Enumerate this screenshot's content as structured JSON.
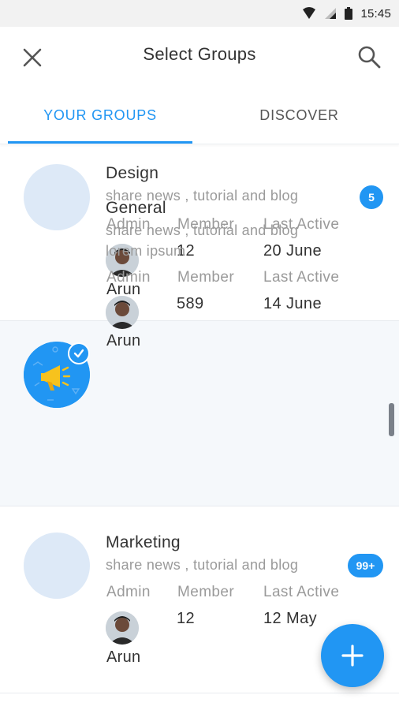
{
  "status_bar": {
    "time": "15:45",
    "icons": [
      "wifi-icon",
      "signal-icon",
      "battery-icon"
    ]
  },
  "app_bar": {
    "title": "Select Groups",
    "left_icon": "close-icon",
    "right_icon": "search-icon"
  },
  "tabs": [
    {
      "label": "YOUR GROUPS",
      "active": true
    },
    {
      "label": "DISCOVER",
      "active": false
    }
  ],
  "labels": {
    "admin": "Admin",
    "member": "Member",
    "last_active": "Last Active"
  },
  "groups": [
    {
      "name": "Design",
      "description": "share news , tutorial and blog",
      "description_line2": "",
      "admin_name": "Arun",
      "member_count": "12",
      "last_active": "20 June",
      "badge": "5",
      "selected": false
    },
    {
      "name": "General",
      "description": "share news , tutorial and blog",
      "description_line2": "lorem ipsum",
      "admin_name": "Arun",
      "member_count": "589",
      "last_active": "14 June",
      "badge": "",
      "selected": true
    },
    {
      "name": "Marketing",
      "description": "share news , tutorial and blog",
      "description_line2": "",
      "admin_name": "Arun",
      "member_count": "12",
      "last_active": "12 May",
      "badge": "99+",
      "selected": false
    }
  ],
  "fab": {
    "icon": "plus-icon"
  },
  "colors": {
    "accent": "#2196f3",
    "avatar_placeholder": "#dde9f7",
    "selected_row": "#f5f8fb"
  }
}
